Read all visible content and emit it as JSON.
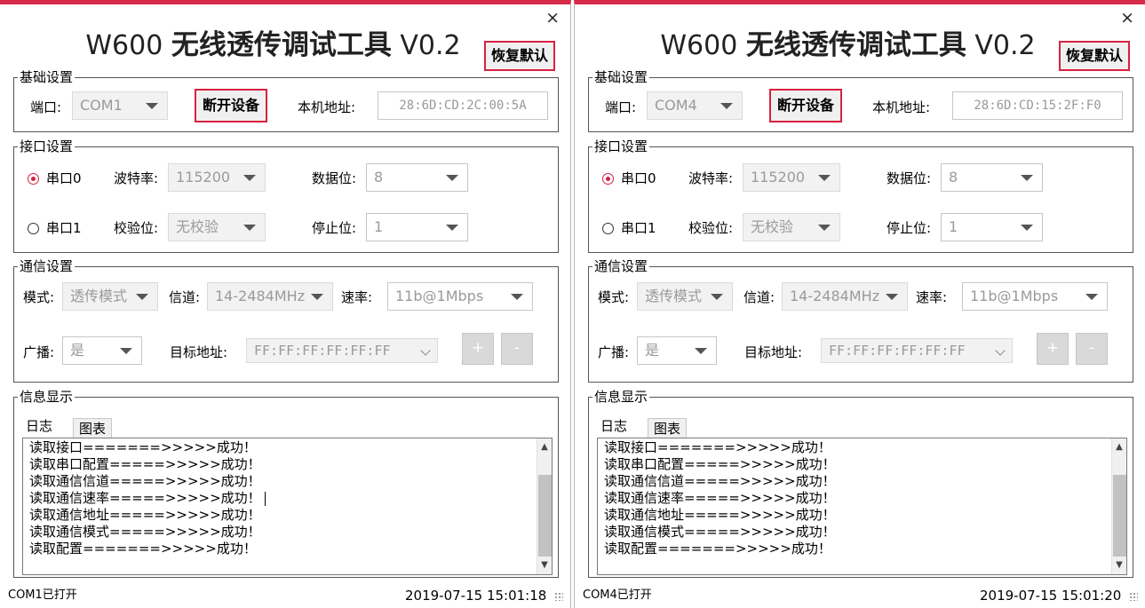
{
  "windows": [
    {
      "close": "×",
      "title_prefix": "W600 ",
      "title_cn": "无线透传调试工具",
      "title_suffix": " V0.2",
      "reset_label": "恢复默认",
      "basic": {
        "legend": "基础设置",
        "port_label": "端口:",
        "port_value": "COM1",
        "disconnect_label": "断开设备",
        "mac_label": "本机地址:",
        "mac_value": "28:6D:CD:2C:00:5A"
      },
      "serial": {
        "legend": "接口设置",
        "uart0_label": "串口0",
        "uart1_label": "串口1",
        "uart_selected": "串口0",
        "baud_label": "波特率:",
        "baud_value": "115200",
        "databits_label": "数据位:",
        "databits_value": "8",
        "parity_label": "校验位:",
        "parity_value": "无校验",
        "stopbits_label": "停止位:",
        "stopbits_value": "1"
      },
      "comm": {
        "legend": "通信设置",
        "mode_label": "模式:",
        "mode_value": "透传模式",
        "channel_label": "信道:",
        "channel_value": "14-2484MHz",
        "rate_label": "速率:",
        "rate_value": "11b@1Mbps",
        "broadcast_label": "广播:",
        "broadcast_value": "是",
        "target_label": "目标地址:",
        "target_value": "FF:FF:FF:FF:FF:FF",
        "plus_label": "+",
        "minus_label": "-"
      },
      "info": {
        "legend": "信息显示",
        "tabs": [
          "日志",
          "图表"
        ],
        "log": [
          "读取接口=======>>>>>成功！",
          "读取串口配置=====>>>>>成功！",
          "读取通信信道=====>>>>>成功！",
          "读取通信速率=====>>>>>成功！",
          "读取通信地址=====>>>>>成功！",
          "读取通信模式=====>>>>>成功！",
          "读取配置=======>>>>>成功！"
        ],
        "scroll_up": "▲",
        "scroll_down": "▼"
      },
      "status_left": "COM1已打开",
      "status_time": "2019-07-15 15:01:18"
    },
    {
      "close": "×",
      "title_prefix": "W600 ",
      "title_cn": "无线透传调试工具",
      "title_suffix": " V0.2",
      "reset_label": "恢复默认",
      "basic": {
        "legend": "基础设置",
        "port_label": "端口:",
        "port_value": "COM4",
        "disconnect_label": "断开设备",
        "mac_label": "本机地址:",
        "mac_value": "28:6D:CD:15:2F:F0"
      },
      "serial": {
        "legend": "接口设置",
        "uart0_label": "串口0",
        "uart1_label": "串口1",
        "uart_selected": "串口0",
        "baud_label": "波特率:",
        "baud_value": "115200",
        "databits_label": "数据位:",
        "databits_value": "8",
        "parity_label": "校验位:",
        "parity_value": "无校验",
        "stopbits_label": "停止位:",
        "stopbits_value": "1"
      },
      "comm": {
        "legend": "通信设置",
        "mode_label": "模式:",
        "mode_value": "透传模式",
        "channel_label": "信道:",
        "channel_value": "14-2484MHz",
        "rate_label": "速率:",
        "rate_value": "11b@1Mbps",
        "broadcast_label": "广播:",
        "broadcast_value": "是",
        "target_label": "目标地址:",
        "target_value": "FF:FF:FF:FF:FF:FF",
        "plus_label": "+",
        "minus_label": "-"
      },
      "info": {
        "legend": "信息显示",
        "tabs": [
          "日志",
          "图表"
        ],
        "log": [
          "读取接口=======>>>>>成功！",
          "读取串口配置=====>>>>>成功！",
          "读取通信信道=====>>>>>成功！",
          "读取通信速率=====>>>>>成功！",
          "读取通信地址=====>>>>>成功！",
          "读取通信模式=====>>>>>成功！",
          "读取配置=======>>>>>成功！"
        ],
        "scroll_up": "▲",
        "scroll_down": "▼"
      },
      "status_left": "COM4已打开",
      "status_time": "2019-07-15 15:01:20"
    }
  ],
  "colors": {
    "accent": "#d62b4a",
    "button_border": "#d9213f",
    "disabled_text": "#9a9a9a",
    "button_face": "#f0f0f0"
  }
}
